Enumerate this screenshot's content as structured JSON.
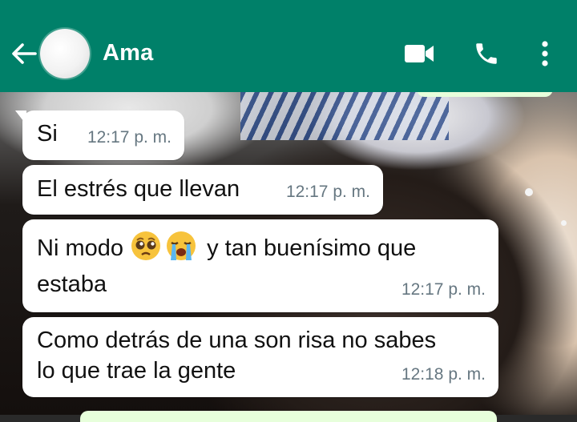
{
  "header": {
    "contact_name": "Ama",
    "back_icon": "arrow-left-icon",
    "video_icon": "video-camera-icon",
    "call_icon": "phone-icon",
    "menu_icon": "more-vertical-icon",
    "bg_color": "#008069"
  },
  "messages": [
    {
      "text": "Si",
      "time": "12:17 p. m."
    },
    {
      "text": "El estrés que llevan",
      "time": "12:17 p. m."
    },
    {
      "text_before": "Ni modo",
      "emojis": [
        "pleading-face",
        "loudly-crying-face"
      ],
      "text_after": "y tan buenísimo que",
      "text_line2": "estaba",
      "time": "12:17 p. m."
    },
    {
      "text_line1": "Como detrás de una son risa no sabes",
      "text_line2": "lo que trae la gente",
      "time": "12:18 p. m."
    }
  ]
}
